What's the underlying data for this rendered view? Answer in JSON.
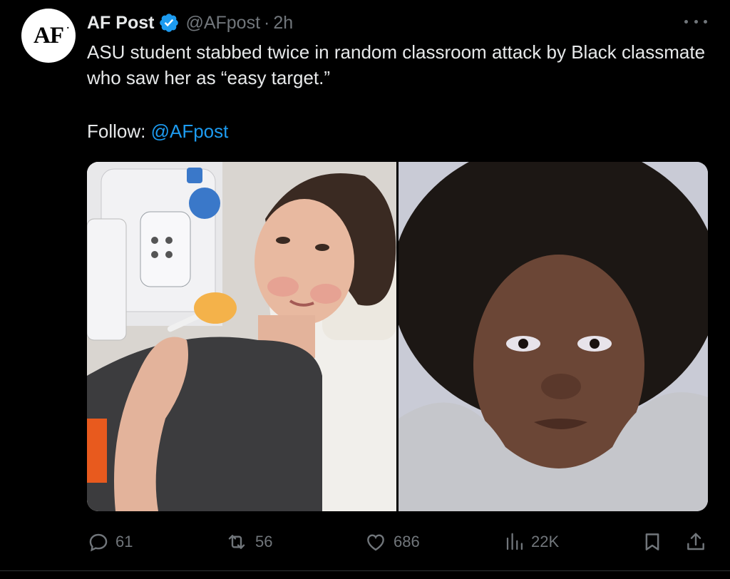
{
  "post": {
    "avatar_text": "AF",
    "avatar_dot": ".",
    "author_name": "AF Post",
    "handle": "@AFpost",
    "separator": "·",
    "time": "2h",
    "text": "ASU student stabbed twice in random classroom attack by Black classmate who saw her as “easy target.”",
    "follow_label": "Follow: ",
    "follow_handle": "@AFpost"
  },
  "icons": {
    "verified": "verified-badge-icon",
    "more": "more-options-icon",
    "reply": "reply-icon",
    "repost": "repost-icon",
    "like": "like-icon",
    "views": "views-icon",
    "bookmark": "bookmark-icon",
    "share": "share-icon"
  },
  "actions": {
    "replies": "61",
    "reposts": "56",
    "likes": "686",
    "views": "22K"
  },
  "colors": {
    "background": "#000000",
    "text": "#e7e9ea",
    "secondary": "#71767b",
    "link": "#1d9bf0",
    "verified": "#1d9bf0"
  }
}
